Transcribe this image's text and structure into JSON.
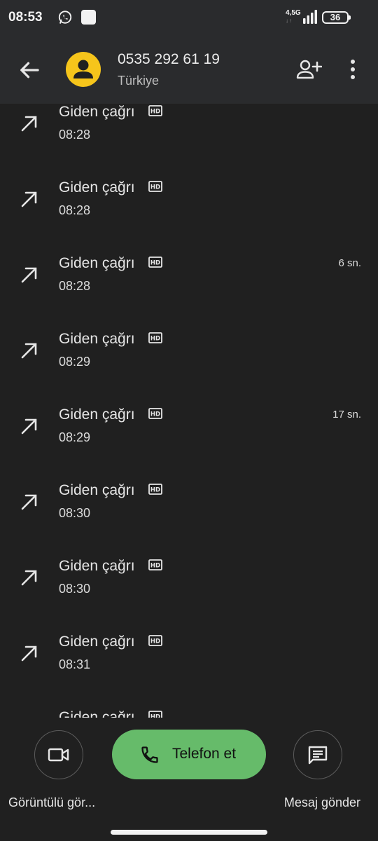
{
  "status_bar": {
    "time": "08:53",
    "network": "4,5G",
    "battery": "36"
  },
  "header": {
    "contact_number": "0535 292 61 19",
    "country": "Türkiye"
  },
  "calls": [
    {
      "type": "Giden çağrı",
      "time": "08:28",
      "duration": ""
    },
    {
      "type": "Giden çağrı",
      "time": "08:28",
      "duration": ""
    },
    {
      "type": "Giden çağrı",
      "time": "08:28",
      "duration": "6 sn."
    },
    {
      "type": "Giden çağrı",
      "time": "08:29",
      "duration": ""
    },
    {
      "type": "Giden çağrı",
      "time": "08:29",
      "duration": "17 sn."
    },
    {
      "type": "Giden çağrı",
      "time": "08:30",
      "duration": ""
    },
    {
      "type": "Giden çağrı",
      "time": "08:30",
      "duration": ""
    },
    {
      "type": "Giden çağrı",
      "time": "08:31",
      "duration": ""
    },
    {
      "type": "Giden çağrı",
      "time": "",
      "duration": ""
    }
  ],
  "actions": {
    "video_label": "Görüntülü gör...",
    "call_label": "Telefon et",
    "message_label": "Mesaj gönder"
  },
  "colors": {
    "accent_green": "#66bb6a",
    "avatar_yellow": "#f6c51b",
    "background": "#202020",
    "appbar": "#2a2b2d"
  },
  "icons": {
    "back": "arrow-back-icon",
    "add_contact": "person-add-icon",
    "more": "more-vert-icon",
    "outgoing": "call-made-icon",
    "hd": "hd-icon",
    "video": "videocam-icon",
    "phone": "phone-icon",
    "message": "message-icon"
  }
}
